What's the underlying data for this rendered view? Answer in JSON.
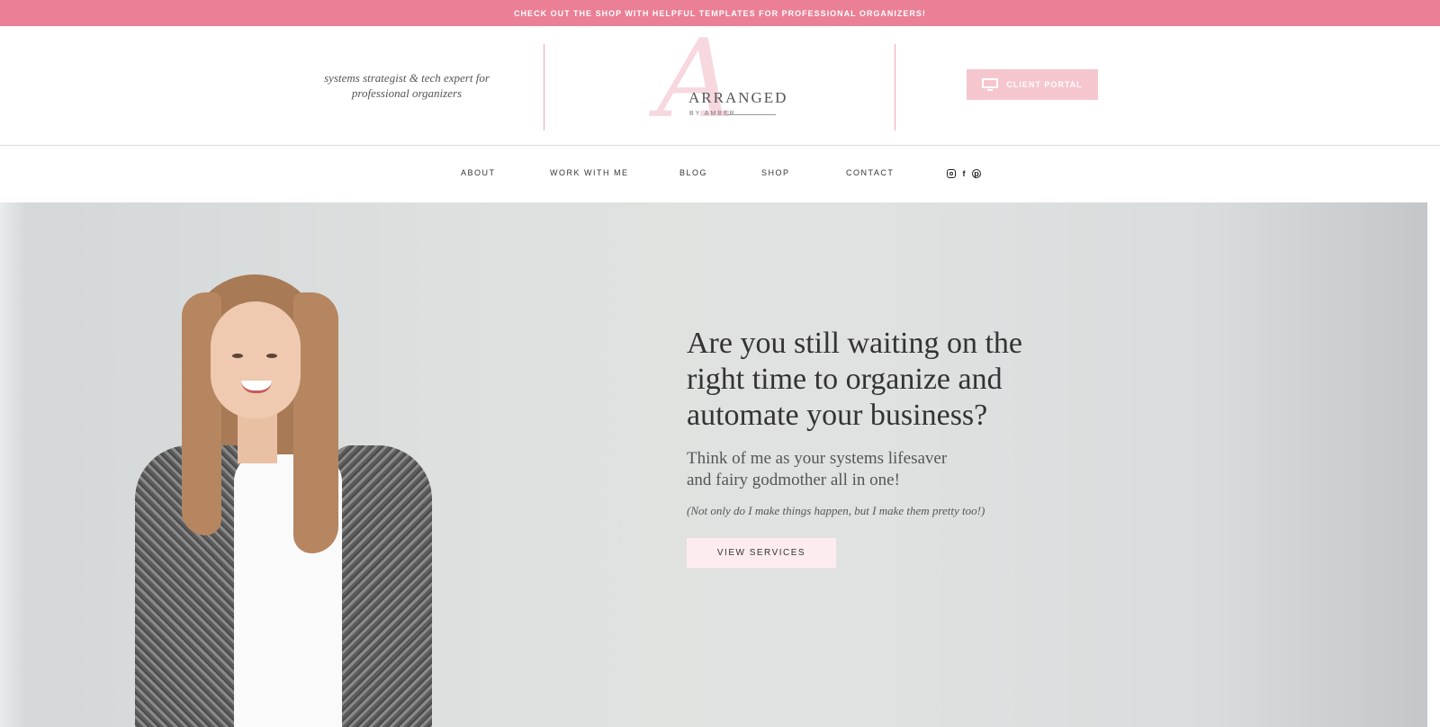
{
  "announcement": {
    "text": "CHECK OUT THE SHOP WITH HELPFUL TEMPLATES FOR PROFESSIONAL ORGANIZERS!"
  },
  "header": {
    "tagline_line1": "systems strategist & tech expert for",
    "tagline_line2": "professional organizers",
    "logo": {
      "mark": "A",
      "word": "ARRANGED",
      "sub": "BY AMBER"
    },
    "portal_button": {
      "label": "CLIENT PORTAL",
      "icon": "monitor-icon"
    }
  },
  "nav": {
    "items": [
      {
        "label": "ABOUT"
      },
      {
        "label": "WORK WITH ME"
      },
      {
        "label": "BLOG"
      },
      {
        "label": "SHOP"
      },
      {
        "label": "CONTACT"
      }
    ],
    "social": [
      "instagram-icon",
      "facebook-icon",
      "pinterest-icon"
    ]
  },
  "hero": {
    "headline_line1": "Are you still waiting on the",
    "headline_line2": "right time to organize and",
    "headline_line3": "automate your business?",
    "subhead_line1": "Think of me as your systems lifesaver",
    "subhead_line2": "and fairy godmother all in one!",
    "aside": "(Not only do I make things happen, but I make them pretty too!)",
    "button_label": "VIEW SERVICES"
  },
  "colors": {
    "announcement_bg": "#ea7f95",
    "portal_button_bg": "#f6c6cf",
    "services_button_bg": "#fdecef",
    "divider": "#f0a6b5"
  }
}
